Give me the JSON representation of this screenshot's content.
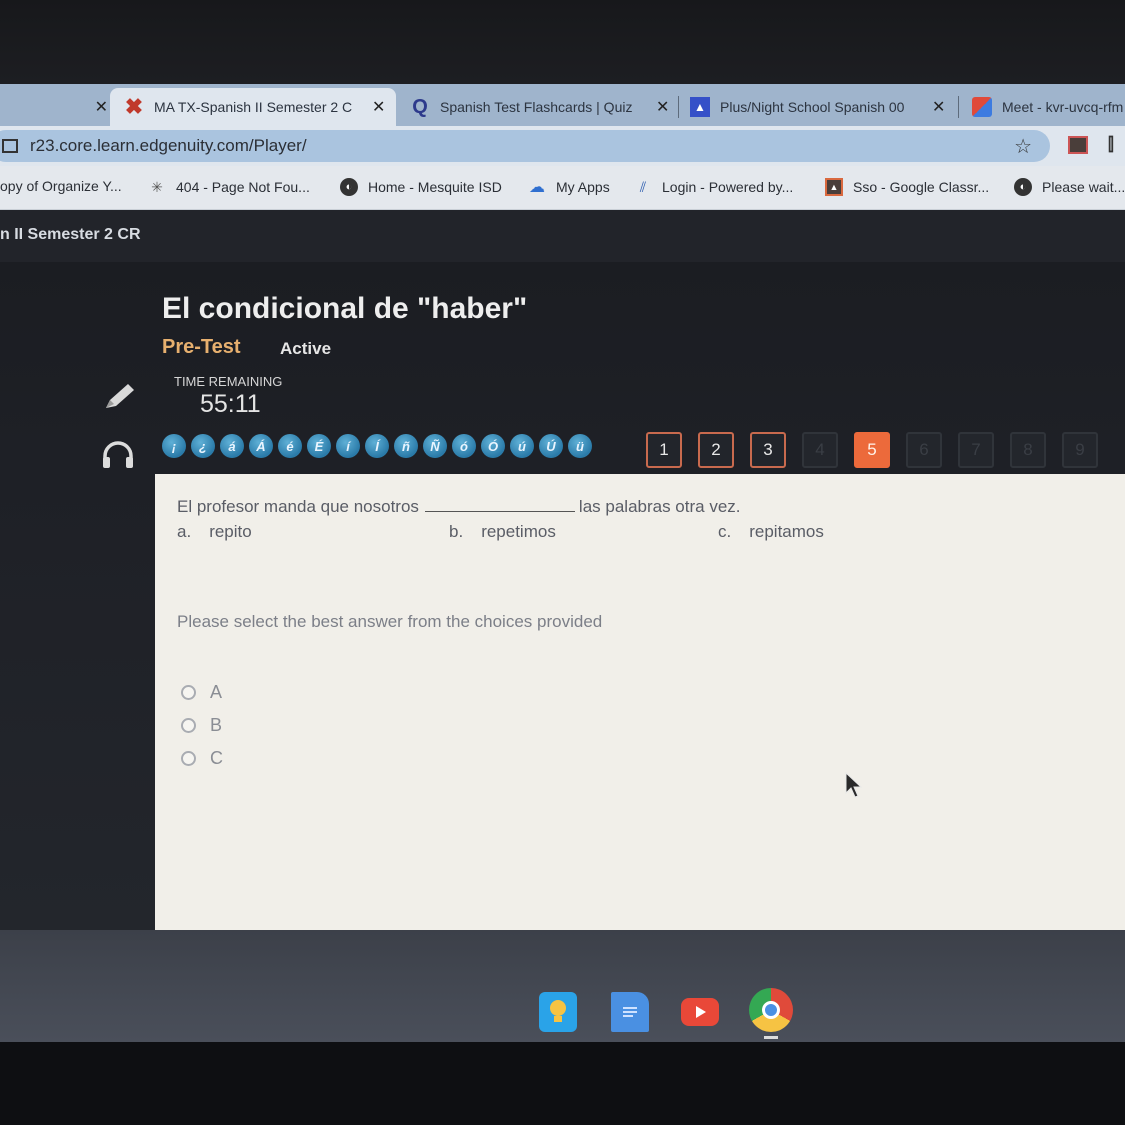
{
  "browser": {
    "tabs": [
      {
        "title": "",
        "icon": "blank-tab-icon",
        "active": false
      },
      {
        "title": "MA TX-Spanish II Semester 2 C",
        "icon": "edgenuity-x-icon",
        "active": true
      },
      {
        "title": "Spanish Test Flashcards | Quiz",
        "icon": "quizlet-q-icon",
        "active": false
      },
      {
        "title": "Plus/Night School Spanish 00",
        "icon": "classroom-icon",
        "active": false
      },
      {
        "title": "Meet - kvr-uvcq-rfm",
        "icon": "meet-icon",
        "active": false
      }
    ],
    "close_glyph": "✕",
    "url": "r23.core.learn.edgenuity.com/Player/",
    "bookmarks": [
      {
        "label": "opy of Organize Y...",
        "icon": "none"
      },
      {
        "label": "404 - Page Not Fou...",
        "icon": "bug-icon"
      },
      {
        "label": "Home - Mesquite ISD",
        "icon": "globe-icon"
      },
      {
        "label": "My Apps",
        "icon": "cloud-icon"
      },
      {
        "label": "Login - Powered by...",
        "icon": "login-icon"
      },
      {
        "label": "Sso - Google Classr...",
        "icon": "classroom-icon"
      },
      {
        "label": "Please wait...",
        "icon": "globe-icon"
      }
    ]
  },
  "app": {
    "course_title": "n II Semester 2 CR",
    "lesson_title": "El condicional de \"haber\"",
    "activity_type": "Pre-Test",
    "status": "Active",
    "time_label": "TIME REMAINING",
    "time_value": "55:11",
    "special_chars": [
      "¡",
      "¿",
      "á",
      "Á",
      "é",
      "É",
      "í",
      "Í",
      "ñ",
      "Ñ",
      "ó",
      "Ó",
      "ú",
      "Ú",
      "ü"
    ],
    "pages": [
      {
        "label": "1",
        "state": "answered"
      },
      {
        "label": "2",
        "state": "answered"
      },
      {
        "label": "3",
        "state": "answered"
      },
      {
        "label": "4",
        "state": "disabled"
      },
      {
        "label": "5",
        "state": "current"
      },
      {
        "label": "6",
        "state": "disabled"
      },
      {
        "label": "7",
        "state": "disabled"
      },
      {
        "label": "8",
        "state": "disabled"
      },
      {
        "label": "9",
        "state": "disabled"
      }
    ],
    "accent_color": "#ec6a3b"
  },
  "question": {
    "before_blank": "El profesor manda que nosotros",
    "after_blank": "las palabras otra vez.",
    "choices": [
      {
        "letter": "a.",
        "text": "repito"
      },
      {
        "letter": "b.",
        "text": "repetimos"
      },
      {
        "letter": "c.",
        "text": "repitamos"
      }
    ],
    "instructions": "Please select the best answer from the choices provided",
    "options": [
      "A",
      "B",
      "C"
    ]
  },
  "shelf": {
    "apps": [
      "keep-icon",
      "docs-icon",
      "youtube-icon",
      "chrome-icon"
    ]
  }
}
